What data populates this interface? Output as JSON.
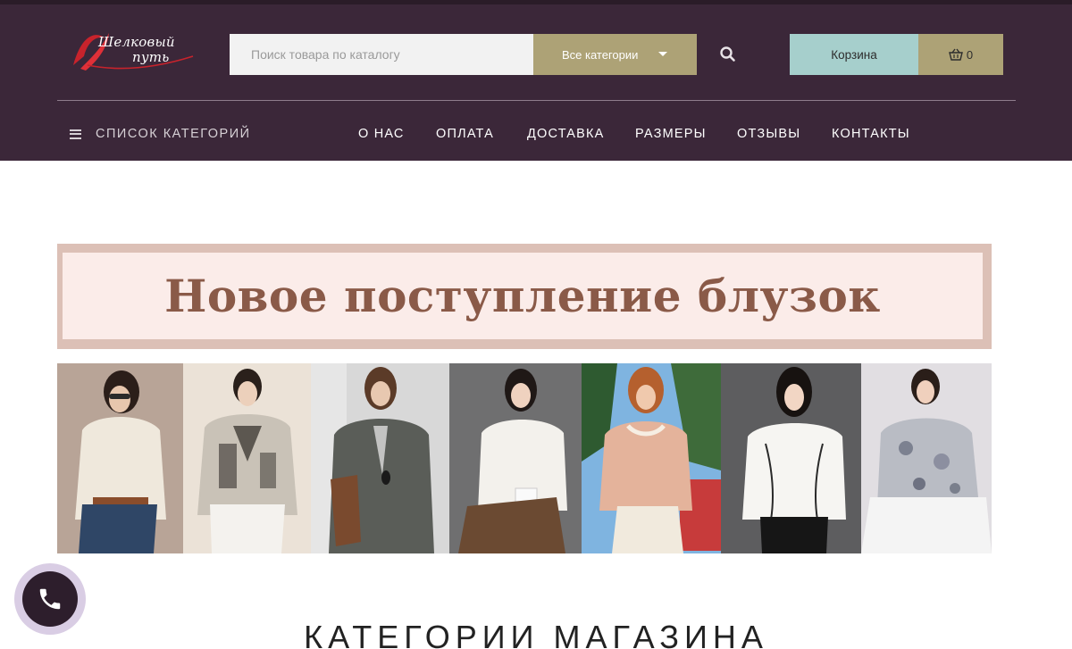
{
  "header": {
    "logo_line1": "Шелковый",
    "logo_line2": "путь",
    "search_placeholder": "Поиск товара по каталогу",
    "category_select": "Все категории",
    "cart_label": "Корзина",
    "cart_count": "0"
  },
  "nav": {
    "categories_label": "СПИСОК КАТЕГОРИЙ",
    "items": [
      "О НАС",
      "ОПЛАТА",
      "ДОСТАВКА",
      "РАЗМЕРЫ",
      "ОТЗЫВЫ",
      "КОНТАКТЫ"
    ]
  },
  "banner": {
    "title": "Новое поступление блузок",
    "photos": [
      "Cream ruffled blouse with jeans",
      "Sheer patterned blouse with white trousers",
      "Grey draped top with pendant",
      "White satin blouse with brown trousers",
      "Peach blouse with embellished collar",
      "White blouse with piped seams",
      "Floral print blouse"
    ]
  },
  "section": {
    "title": "КАТЕГОРИИ МАГАЗИНА"
  },
  "colors": {
    "header_bg": "#3b2739",
    "accent_gold": "#ada276",
    "accent_mint": "#a6cfcc",
    "banner_text": "#8a5a48"
  },
  "icons": [
    "search-icon",
    "basket-icon",
    "menu-icon",
    "phone-icon",
    "chevron-down-icon"
  ]
}
